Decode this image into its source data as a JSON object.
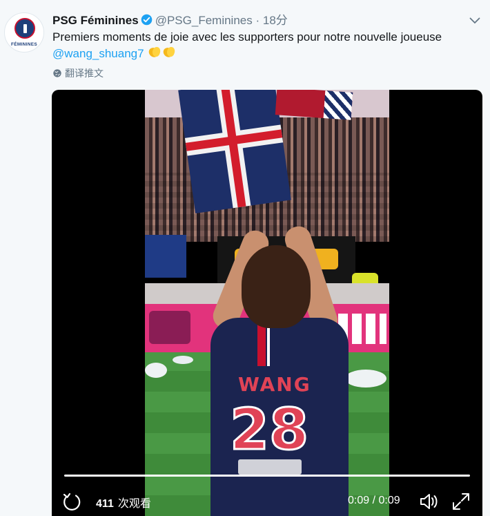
{
  "account": {
    "display_name": "PSG Féminines",
    "handle": "@PSG_Feminines",
    "separator": "·",
    "timestamp": "18分",
    "avatar_caption": "FÉMININES",
    "verified_icon": "verified-badge-icon"
  },
  "tweet": {
    "text": "Premiers moments de joie avec les supporters pour notre nouvelle joueuse",
    "mention": "@wang_shuang7",
    "emoji": [
      "clapping-hands",
      "clapping-hands"
    ]
  },
  "translate": {
    "label": "翻译推文",
    "icon": "globe-icon"
  },
  "video": {
    "jersey_name": "WANG",
    "jersey_number": "28",
    "view_count": "411",
    "views_label": "次观看",
    "time_current": "0:09",
    "time_separator": "/",
    "time_total": "0:09",
    "progress": 1.0
  },
  "colors": {
    "mention": "#1da1f2",
    "secondary_text": "#657786",
    "jersey_navy": "#1b2450",
    "jersey_red": "#e04356",
    "board_pink": "#e2337c"
  }
}
